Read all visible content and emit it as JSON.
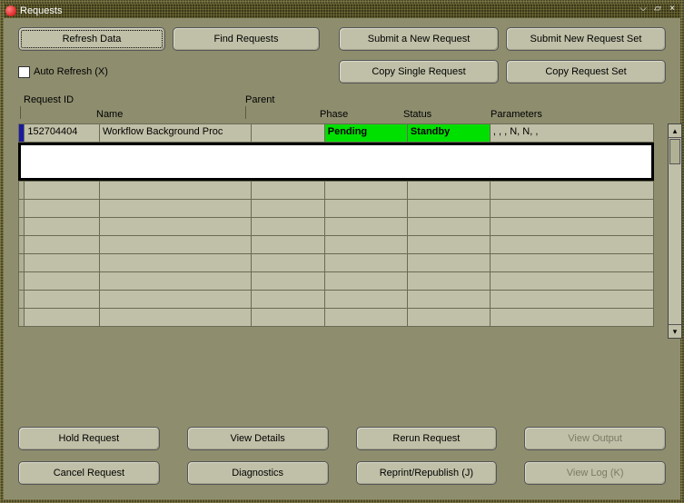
{
  "window": {
    "title": "Requests"
  },
  "toolbar": {
    "refresh": "Refresh Data",
    "find": "Find Requests",
    "submit_new": "Submit a New Request",
    "submit_set": "Submit New Request Set",
    "copy_single": "Copy Single Request",
    "copy_set": "Copy Request Set",
    "auto_refresh_label": "Auto Refresh (X)"
  },
  "headers": {
    "request_id": "Request ID",
    "parent": "Parent",
    "name": "Name",
    "phase": "Phase",
    "status": "Status",
    "parameters": "Parameters"
  },
  "rows": [
    {
      "id": "152704404",
      "name": "Workflow Background Proc",
      "parent": "",
      "phase": "Pending",
      "status": "Standby",
      "parameters": ", , , N, N, ,"
    }
  ],
  "footer": {
    "hold": "Hold Request",
    "view_details": "View Details",
    "rerun": "Rerun Request",
    "view_output": "View Output",
    "cancel": "Cancel Request",
    "diagnostics": "Diagnostics",
    "reprint": "Reprint/Republish (J)",
    "view_log": "View Log (K)"
  },
  "colors": {
    "status_green": "#00e000",
    "window_bg": "#8e8e6f",
    "button_bg": "#c0c0a8"
  }
}
